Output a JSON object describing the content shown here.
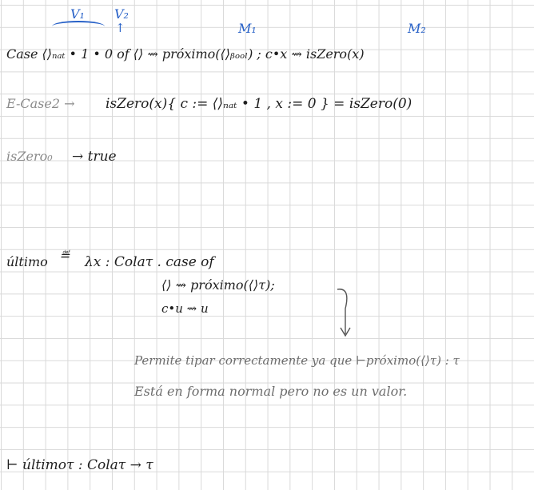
{
  "annotations": {
    "v1": "V₁",
    "v2": "V₂",
    "m1": "M₁",
    "m2": "M₂"
  },
  "lines": {
    "case_expr": "Case ⟨⟩ₙₐₜ • 1 • 0  of  ⟨⟩ ⇝ próximo(⟨⟩ᵦₒₒₗ) ;  c•x ⇝ isZero(x)",
    "ecase_label": "E-Case2 →",
    "ecase_body": "isZero(x){ c := ⟨⟩ₙₐₜ • 1 ,  x := 0 }  =  isZero(0)",
    "iszero_label": "isZero₀",
    "iszero_body": "→  true",
    "ultimo_def_label": "último",
    "ultimo_def_eq": "≝",
    "ultimo_def_body": "λx : Cola𝜏 .  case  of",
    "case_empty": "⟨⟩  ⇝  próximo(⟨⟩𝜏);",
    "case_cons": "c•u ⇝ u",
    "typing": "⊢ último𝜏  :  Cola𝜏  →  𝜏"
  },
  "notes": {
    "note1": "Permite tipar correctamente ya que ⊢próximo(⟨⟩𝜏) : 𝜏",
    "note2": "Está en forma normal pero no es un valor."
  },
  "colors": {
    "annotation": "#2962c8",
    "ink": "#1e1e1e",
    "muted": "#8a8a8a",
    "note": "#6d6d6d",
    "grid": "#d9d9d9"
  }
}
